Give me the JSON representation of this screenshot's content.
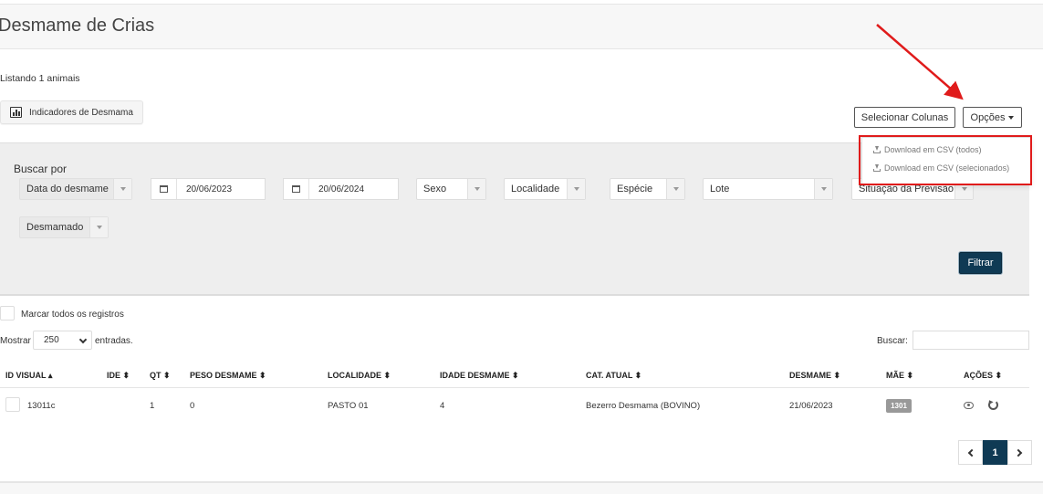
{
  "header": {
    "title": "Desmame de Crias"
  },
  "listing": {
    "text": "Listando 1 animais"
  },
  "indicators_button": {
    "label": "Indicadores de Desmama"
  },
  "toolbar": {
    "select_columns": "Selecionar Colunas",
    "options": "Opções"
  },
  "options_menu": {
    "items": [
      "Download em CSV (todos)",
      "Download em CSV (selecionados)"
    ]
  },
  "filters": {
    "label": "Buscar por",
    "date_field": "Data do desmame",
    "date_from": "20/06/2023",
    "date_to": "20/06/2024",
    "sexo": "Sexo",
    "localidade": "Localidade",
    "especie": "Espécie",
    "lote": "Lote",
    "situacao": "Situação da Previsão",
    "status": "Desmamado",
    "submit": "Filtrar"
  },
  "table_controls": {
    "mark_all": "Marcar todos os registros",
    "show_label": "Mostrar",
    "show_value": "250",
    "entries_label": "entradas.",
    "search_label": "Buscar:"
  },
  "table": {
    "columns": [
      "ID VISUAL",
      "IDE",
      "QT",
      "PESO DESMAME",
      "LOCALIDADE",
      "IDADE DESMAME",
      "CAT. ATUAL",
      "DESMAME",
      "MÃE",
      "AÇÕES"
    ],
    "rows": [
      {
        "id_visual": "13011c",
        "ide": "",
        "qt": "1",
        "peso_desmame": "0",
        "localidade": "PASTO 01",
        "idade_desmame": "4",
        "cat_atual": "Bezerro Desmama (BOVINO)",
        "desmame": "21/06/2023",
        "mae": "1301"
      }
    ]
  },
  "pagination": {
    "current": "1"
  },
  "colors": {
    "primary": "#0f3a54",
    "annotation": "#e01b1b",
    "badge": "#999999"
  }
}
